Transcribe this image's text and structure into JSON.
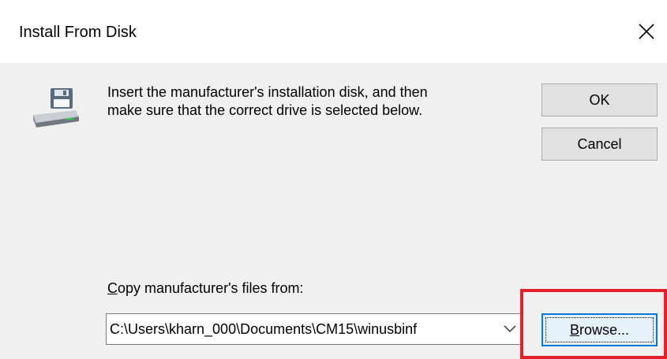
{
  "window": {
    "title": "Install From Disk",
    "close_icon": "close-icon"
  },
  "content": {
    "icon": "floppy-drive-icon",
    "instruction_line1": "Insert the manufacturer's installation disk, and then",
    "instruction_line2": "make sure that the correct drive is selected below."
  },
  "buttons": {
    "ok_label": "OK",
    "cancel_label": "Cancel",
    "browse_label": "Browse...",
    "browse_accel": "B",
    "browse_rest": "rowse..."
  },
  "copy_from": {
    "label": "Copy manufacturer's files from:",
    "label_accel": "C",
    "label_rest": "opy manufacturer's files from:",
    "value": "C:\\Users\\kharn_000\\Documents\\CM15\\winusbinf",
    "dropdown_icon": "chevron-down-icon"
  },
  "annotation": {
    "color": "#e3212d",
    "target": "browse-button"
  },
  "colors": {
    "dialog_bg": "#f0f0f0",
    "button_bg": "#e1e1e1",
    "focus_blue": "#0078d7"
  }
}
